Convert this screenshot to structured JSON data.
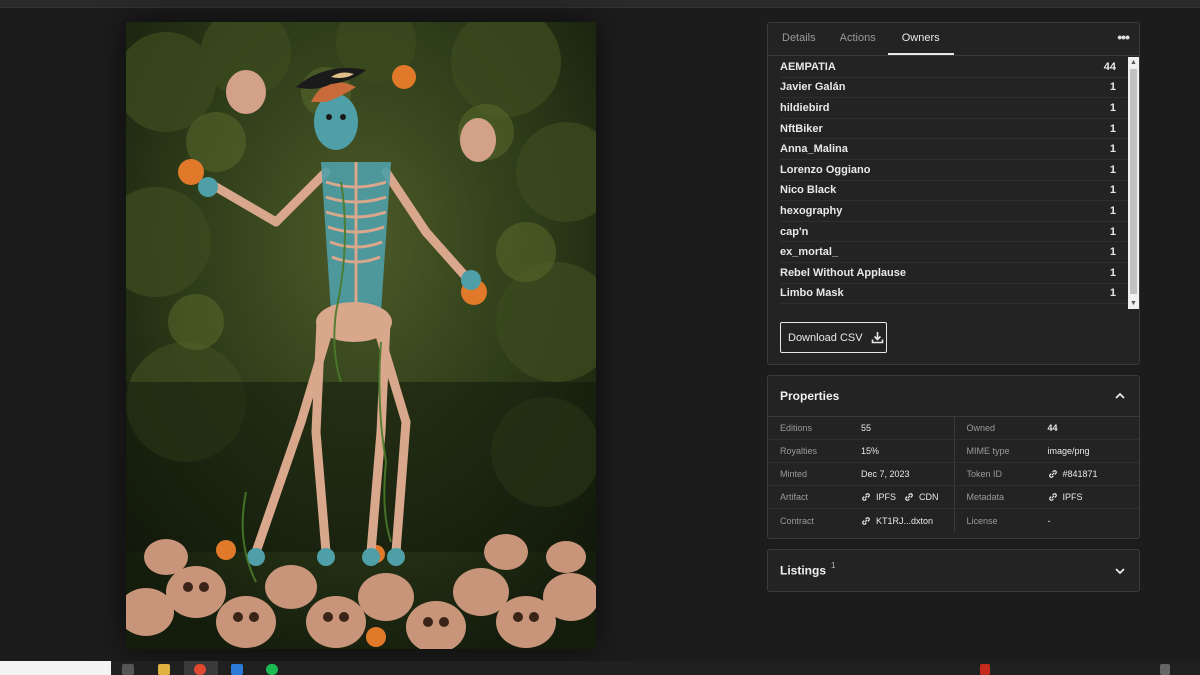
{
  "tabs": [
    {
      "label": "Details"
    },
    {
      "label": "Actions"
    },
    {
      "label": "Owners"
    }
  ],
  "more_label": "•••",
  "owners": [
    {
      "name": "AEMPATIA",
      "count": "44"
    },
    {
      "name": "Javier Galán",
      "count": "1"
    },
    {
      "name": "hildiebird",
      "count": "1"
    },
    {
      "name": "NftBiker",
      "count": "1"
    },
    {
      "name": "Anna_Malina",
      "count": "1"
    },
    {
      "name": "Lorenzo Oggiano",
      "count": "1"
    },
    {
      "name": "Nico Black",
      "count": "1"
    },
    {
      "name": "hexography",
      "count": "1"
    },
    {
      "name": "cap'n",
      "count": "1"
    },
    {
      "name": "ex_mortal_",
      "count": "1"
    },
    {
      "name": "Rebel Without Applause",
      "count": "1"
    },
    {
      "name": "Limbo Mask",
      "count": "1"
    }
  ],
  "download_label": "Download CSV",
  "properties": {
    "title": "Properties",
    "editions_label": "Editions",
    "editions_value": "55",
    "owned_label": "Owned",
    "owned_value": "44",
    "royalties_label": "Royalties",
    "royalties_value": "15%",
    "mime_label": "MIME type",
    "mime_value": "image/png",
    "minted_label": "Minted",
    "minted_value": "Dec 7, 2023",
    "token_label": "Token ID",
    "token_value": "#841871",
    "artifact_label": "Artifact",
    "artifact_link1": "IPFS",
    "artifact_link2": "CDN",
    "metadata_label": "Metadata",
    "metadata_link": "IPFS",
    "contract_label": "Contract",
    "contract_value": "KT1RJ...dxton",
    "license_label": "License",
    "license_value": "-"
  },
  "listings": {
    "title": "Listings",
    "count": "1"
  },
  "icons": {
    "more": "ellipsis-icon",
    "download": "download-icon",
    "chevron_up": "chevron-up-icon",
    "chevron_down": "chevron-down-icon",
    "link": "link-icon"
  },
  "colors": {
    "panel_bg": "#232323",
    "page_bg": "#1c1c1c",
    "border": "#3a3a3a",
    "text": "#e8e8e8",
    "muted": "#9a9a9a"
  }
}
